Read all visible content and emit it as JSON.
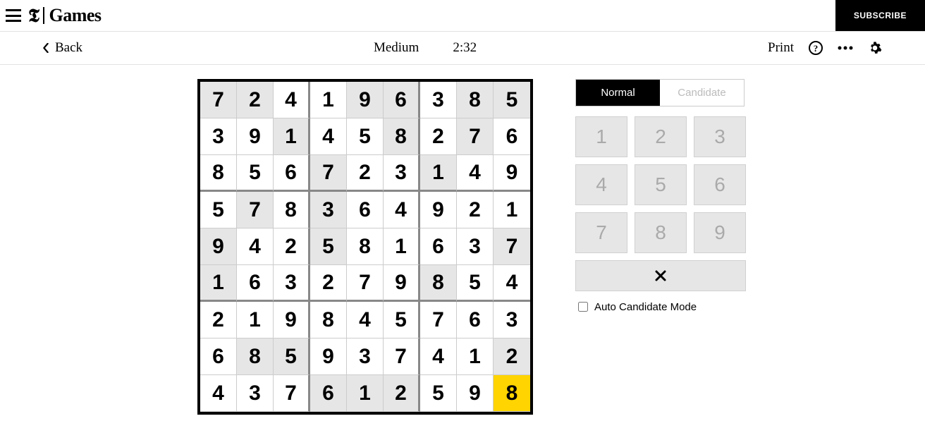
{
  "header": {
    "brand_t": "𝕿",
    "brand_word": "Games",
    "subscribe": "SUBSCRIBE"
  },
  "toolbar": {
    "back": "Back",
    "difficulty": "Medium",
    "timer": "2:32",
    "print": "Print"
  },
  "board": {
    "cells": [
      [
        {
          "v": "7",
          "g": true
        },
        {
          "v": "2",
          "g": true
        },
        {
          "v": "4",
          "g": false
        },
        {
          "v": "1",
          "g": false
        },
        {
          "v": "9",
          "g": true
        },
        {
          "v": "6",
          "g": true
        },
        {
          "v": "3",
          "g": false
        },
        {
          "v": "8",
          "g": true
        },
        {
          "v": "5",
          "g": true
        }
      ],
      [
        {
          "v": "3",
          "g": false
        },
        {
          "v": "9",
          "g": false
        },
        {
          "v": "1",
          "g": true
        },
        {
          "v": "4",
          "g": false
        },
        {
          "v": "5",
          "g": false
        },
        {
          "v": "8",
          "g": true
        },
        {
          "v": "2",
          "g": false
        },
        {
          "v": "7",
          "g": true
        },
        {
          "v": "6",
          "g": false
        }
      ],
      [
        {
          "v": "8",
          "g": false
        },
        {
          "v": "5",
          "g": false
        },
        {
          "v": "6",
          "g": false
        },
        {
          "v": "7",
          "g": true
        },
        {
          "v": "2",
          "g": false
        },
        {
          "v": "3",
          "g": false
        },
        {
          "v": "1",
          "g": true
        },
        {
          "v": "4",
          "g": false
        },
        {
          "v": "9",
          "g": false
        }
      ],
      [
        {
          "v": "5",
          "g": false
        },
        {
          "v": "7",
          "g": true
        },
        {
          "v": "8",
          "g": false
        },
        {
          "v": "3",
          "g": true
        },
        {
          "v": "6",
          "g": false
        },
        {
          "v": "4",
          "g": false
        },
        {
          "v": "9",
          "g": false
        },
        {
          "v": "2",
          "g": false
        },
        {
          "v": "1",
          "g": false
        }
      ],
      [
        {
          "v": "9",
          "g": true
        },
        {
          "v": "4",
          "g": false
        },
        {
          "v": "2",
          "g": false
        },
        {
          "v": "5",
          "g": true
        },
        {
          "v": "8",
          "g": false
        },
        {
          "v": "1",
          "g": false
        },
        {
          "v": "6",
          "g": false
        },
        {
          "v": "3",
          "g": false
        },
        {
          "v": "7",
          "g": true
        }
      ],
      [
        {
          "v": "1",
          "g": true
        },
        {
          "v": "6",
          "g": false
        },
        {
          "v": "3",
          "g": false
        },
        {
          "v": "2",
          "g": false
        },
        {
          "v": "7",
          "g": false
        },
        {
          "v": "9",
          "g": false
        },
        {
          "v": "8",
          "g": true
        },
        {
          "v": "5",
          "g": false
        },
        {
          "v": "4",
          "g": false
        }
      ],
      [
        {
          "v": "2",
          "g": false
        },
        {
          "v": "1",
          "g": false
        },
        {
          "v": "9",
          "g": false
        },
        {
          "v": "8",
          "g": false
        },
        {
          "v": "4",
          "g": false
        },
        {
          "v": "5",
          "g": false
        },
        {
          "v": "7",
          "g": false
        },
        {
          "v": "6",
          "g": false
        },
        {
          "v": "3",
          "g": false
        }
      ],
      [
        {
          "v": "6",
          "g": false
        },
        {
          "v": "8",
          "g": true
        },
        {
          "v": "5",
          "g": true
        },
        {
          "v": "9",
          "g": false
        },
        {
          "v": "3",
          "g": false
        },
        {
          "v": "7",
          "g": false
        },
        {
          "v": "4",
          "g": false
        },
        {
          "v": "1",
          "g": false
        },
        {
          "v": "2",
          "g": true
        }
      ],
      [
        {
          "v": "4",
          "g": false
        },
        {
          "v": "3",
          "g": false
        },
        {
          "v": "7",
          "g": false
        },
        {
          "v": "6",
          "g": true
        },
        {
          "v": "1",
          "g": true
        },
        {
          "v": "2",
          "g": true
        },
        {
          "v": "5",
          "g": false
        },
        {
          "v": "9",
          "g": false
        },
        {
          "v": "8",
          "g": false,
          "sel": true
        }
      ]
    ]
  },
  "panel": {
    "mode_normal": "Normal",
    "mode_candidate": "Candidate",
    "keys": [
      "1",
      "2",
      "3",
      "4",
      "5",
      "6",
      "7",
      "8",
      "9"
    ],
    "erase": "✕",
    "auto_label": "Auto Candidate Mode"
  }
}
